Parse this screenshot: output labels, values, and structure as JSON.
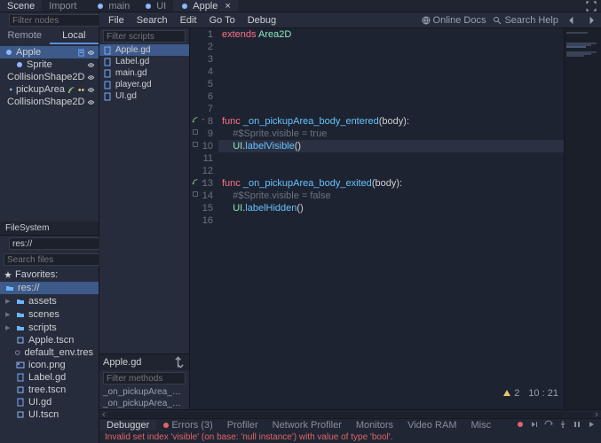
{
  "dock_tabs": {
    "scene": "Scene",
    "import": "Import"
  },
  "top_scene_tabs": [
    {
      "label": "main",
      "selected": false
    },
    {
      "label": "UI",
      "selected": false
    },
    {
      "label": "Apple",
      "selected": true
    }
  ],
  "scene_panel": {
    "filter_placeholder": "Filter nodes",
    "remote_label": "Remote",
    "local_label": "Local",
    "tree": [
      {
        "name": "Apple",
        "indent": 0,
        "selected": true,
        "icons": [
          "script",
          "vis"
        ]
      },
      {
        "name": "Sprite",
        "indent": 12,
        "selected": false,
        "icons": [
          "vis"
        ]
      },
      {
        "name": "CollisionShape2D",
        "indent": 12,
        "selected": false,
        "icons": [
          "vis"
        ]
      },
      {
        "name": "pickupArea",
        "indent": 12,
        "selected": false,
        "icons": [
          "signal",
          "group",
          "vis"
        ]
      },
      {
        "name": "CollisionShape2D",
        "indent": 24,
        "selected": false,
        "icons": [
          "vis"
        ]
      }
    ]
  },
  "filesystem": {
    "tab": "FileSystem",
    "path": "res://",
    "search_placeholder": "Search files",
    "favorites_label": "Favorites:",
    "root": "res://",
    "items": [
      {
        "name": "assets",
        "kind": "folder"
      },
      {
        "name": "scenes",
        "kind": "folder"
      },
      {
        "name": "scripts",
        "kind": "folder"
      },
      {
        "name": "Apple.tscn",
        "kind": "scene"
      },
      {
        "name": "default_env.tres",
        "kind": "res"
      },
      {
        "name": "icon.png",
        "kind": "img"
      },
      {
        "name": "Label.gd",
        "kind": "gd"
      },
      {
        "name": "tree.tscn",
        "kind": "scene"
      },
      {
        "name": "UI.gd",
        "kind": "gd"
      },
      {
        "name": "UI.tscn",
        "kind": "scene"
      }
    ]
  },
  "menu": {
    "file": "File",
    "search": "Search",
    "edit": "Edit",
    "goto": "Go To",
    "debug": "Debug",
    "online_docs": "Online Docs",
    "search_help": "Search Help"
  },
  "script_panel": {
    "filter_scripts_placeholder": "Filter scripts",
    "scripts": [
      {
        "name": "Apple.gd",
        "selected": true
      },
      {
        "name": "Label.gd",
        "selected": false
      },
      {
        "name": "main.gd",
        "selected": false
      },
      {
        "name": "player.gd",
        "selected": false
      },
      {
        "name": "UI.gd",
        "selected": false
      }
    ],
    "current_script": "Apple.gd",
    "filter_methods_placeholder": "Filter methods",
    "methods": [
      "_on_pickupArea_body_entered",
      "_on_pickupArea_body_exited"
    ]
  },
  "code": {
    "highlight_line": 10,
    "lines": [
      {
        "n": 1,
        "tokens": [
          [
            "kw",
            "extends"
          ],
          [
            "sp",
            " "
          ],
          [
            "cls",
            "Area2D"
          ]
        ]
      },
      {
        "n": 2,
        "tokens": []
      },
      {
        "n": 3,
        "tokens": []
      },
      {
        "n": 4,
        "tokens": []
      },
      {
        "n": 5,
        "tokens": []
      },
      {
        "n": 6,
        "tokens": []
      },
      {
        "n": 7,
        "tokens": []
      },
      {
        "n": 8,
        "marks": [
          "conn",
          "fold"
        ],
        "tokens": [
          [
            "kw",
            "func"
          ],
          [
            "sp",
            " "
          ],
          [
            "fn",
            "_on_pickupArea_body_entered"
          ],
          [
            "txt",
            "("
          ],
          [
            "txt",
            "body"
          ],
          [
            "txt",
            "):"
          ]
        ]
      },
      {
        "n": 9,
        "marks": [
          "bm"
        ],
        "tokens": [
          [
            "sp",
            "    "
          ],
          [
            "cmt",
            "#$Sprite.visible = true"
          ]
        ]
      },
      {
        "n": 10,
        "marks": [
          "bm"
        ],
        "tokens": [
          [
            "sp",
            "    "
          ],
          [
            "cls",
            "UI"
          ],
          [
            "txt",
            "."
          ],
          [
            "fn",
            "labelVisible"
          ],
          [
            "txt",
            "()"
          ]
        ]
      },
      {
        "n": 11,
        "tokens": []
      },
      {
        "n": 12,
        "tokens": []
      },
      {
        "n": 13,
        "marks": [
          "conn",
          "fold"
        ],
        "tokens": [
          [
            "kw",
            "func"
          ],
          [
            "sp",
            " "
          ],
          [
            "fn",
            "_on_pickupArea_body_exited"
          ],
          [
            "txt",
            "("
          ],
          [
            "txt",
            "body"
          ],
          [
            "txt",
            "):"
          ]
        ]
      },
      {
        "n": 14,
        "marks": [
          "bm"
        ],
        "tokens": [
          [
            "sp",
            "    "
          ],
          [
            "cmt",
            "#$Sprite.visible = false"
          ]
        ]
      },
      {
        "n": 15,
        "tokens": [
          [
            "sp",
            "    "
          ],
          [
            "cls",
            "UI"
          ],
          [
            "txt",
            "."
          ],
          [
            "fn",
            "labelHidden"
          ],
          [
            "txt",
            "()"
          ]
        ]
      },
      {
        "n": 16,
        "tokens": []
      }
    ]
  },
  "code_status": {
    "warnings": "2",
    "line": "10",
    "col": "21",
    "sep": ":"
  },
  "bottom_panel": {
    "tabs": {
      "debugger": "Debugger",
      "errors": "Errors (3)",
      "profiler": "Profiler",
      "network": "Network Profiler",
      "monitors": "Monitors",
      "vram": "Video RAM",
      "misc": "Misc"
    },
    "error_text": "Invalid set index 'visible' (on base: 'null instance') with value of type 'bool'."
  },
  "colors": {
    "accent": "#5a8de0",
    "error": "#e06666"
  }
}
